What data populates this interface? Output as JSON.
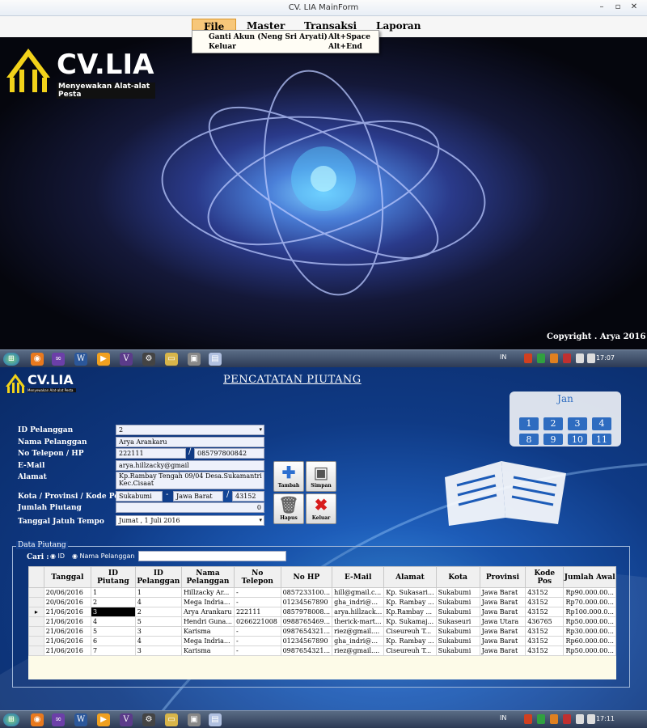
{
  "window1": {
    "title": "CV. LIA MainForm",
    "menu": [
      "File",
      "Master",
      "Transaksi",
      "Laporan"
    ],
    "dropdown": [
      {
        "label": "Ganti Akun  (Neng Sri Aryati)",
        "shortcut": "Alt+Space"
      },
      {
        "label": "Keluar",
        "shortcut": "Alt+End"
      }
    ],
    "logo_text": "CV.LIA",
    "logo_subtitle": "Menyewakan Alat-alat Pesta",
    "copyright": "Copyright . Arya 2016"
  },
  "taskbar1": {
    "lang": "IN",
    "clock": "17:07"
  },
  "taskbar2": {
    "lang": "IN",
    "clock": "17:11"
  },
  "window2": {
    "logo_text": "CV.LIA",
    "logo_subtitle": "Menyewakan Alat-alat Pesta",
    "form_title": "PENCATATAN PIUTANG",
    "labels": {
      "id_pelanggan": "ID Pelanggan",
      "nama_pelanggan": "Nama Pelanggan",
      "no_telepon": "No Telepon / HP",
      "email": "E-Mail",
      "alamat": "Alamat",
      "kota": "Kota / Provinsi / Kode Pos",
      "jumlah_piutang": "Jumlah Piutang",
      "jatuh_tempo": "Tanggal Jatuh Tempo"
    },
    "values": {
      "id_pelanggan": "2",
      "nama_pelanggan": "Arya Arankaru",
      "telepon": "222111",
      "hp": "085797800842",
      "email": "arya.hillzacky@gmail",
      "alamat": "Kp.Rambay Tengah 09/04 Desa.Sukamantri Kec.Cisaat",
      "kota": "Sukabumi",
      "provinsi": "Jawa Barat",
      "kode_pos": "43152",
      "jumlah_piutang": "0",
      "jatuh_tempo": "Jumat ,   1      Juli       2016"
    },
    "buttons": {
      "tambah": "Tambah",
      "simpan": "Simpan",
      "hapus": "Hapus",
      "keluar": "Keluar"
    },
    "calendar": {
      "month": "Jan",
      "days": [
        "1",
        "2",
        "3",
        "4",
        "8",
        "9",
        "10",
        "11"
      ]
    },
    "group_title": "Data Piutang",
    "search": {
      "label": "Cari :",
      "opt_id": "ID",
      "opt_nama": "Nama Pelanggan",
      "value": ""
    },
    "table": {
      "headers": [
        "Tanggal",
        "ID Piutang",
        "ID Pelanggan",
        "Nama Pelanggan",
        "No Telepon",
        "No HP",
        "E-Mail",
        "Alamat",
        "Kota",
        "Provinsi",
        "Kode Pos",
        "Jumlah Awal"
      ],
      "rows": [
        [
          "20/06/2016",
          "1",
          "1",
          "Hillzacky Ar...",
          "-",
          "0857233100...",
          "hill@gmail.c...",
          "Kp. Sukasari...",
          "Sukabumi",
          "Jawa Barat",
          "43152",
          "Rp90.000.00..."
        ],
        [
          "20/06/2016",
          "2",
          "4",
          "Mega Indria...",
          "-",
          "01234567890",
          "gha_indri@...",
          "Kp. Rambay ...",
          "Sukabumi",
          "Jawa Barat",
          "43152",
          "Rp70.000.00..."
        ],
        [
          "21/06/2016",
          "3",
          "2",
          "Arya Arankaru",
          "222111",
          "0857978008...",
          "arya.hillzack...",
          "Kp.Rambay ...",
          "Sukabumi",
          "Jawa Barat",
          "43152",
          "Rp100.000.0..."
        ],
        [
          "21/06/2016",
          "4",
          "5",
          "Hendri Guna...",
          "0266221008",
          "0988765469...",
          "therick-mart...",
          "Kp. Sukamaj...",
          "Sukaseuri",
          "Jawa Utara",
          "436765",
          "Rp50.000.00..."
        ],
        [
          "21/06/2016",
          "5",
          "3",
          "Karisma",
          "-",
          "0987654321...",
          "riez@gmail....",
          "Ciseureuh T...",
          "Sukabumi",
          "Jawa Barat",
          "43152",
          "Rp30.000.00..."
        ],
        [
          "21/06/2016",
          "6",
          "4",
          "Mega Indria...",
          "-",
          "01234567890",
          "gha_indri@...",
          "Kp. Rambay ...",
          "Sukabumi",
          "Jawa Barat",
          "43152",
          "Rp60.000.00..."
        ],
        [
          "21/06/2016",
          "7",
          "3",
          "Karisma",
          "-",
          "0987654321...",
          "riez@gmail....",
          "Ciseureuh T...",
          "Sukabumi",
          "Jawa Barat",
          "43152",
          "Rp50.000.00..."
        ]
      ]
    }
  }
}
